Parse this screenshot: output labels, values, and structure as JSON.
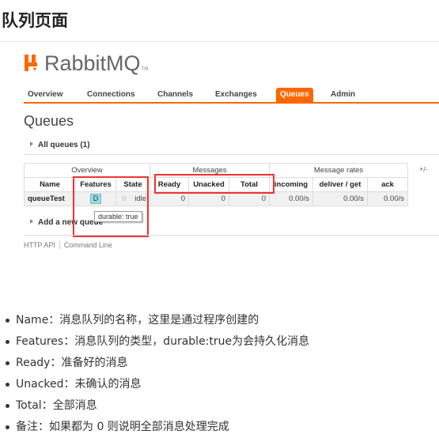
{
  "page": {
    "title": "队列页面"
  },
  "app": {
    "logo_text": "RabbitMQ",
    "logo_tm": "TM",
    "brand_color": "#ff6600"
  },
  "nav": {
    "tabs": [
      {
        "label": "Overview"
      },
      {
        "label": "Connections"
      },
      {
        "label": "Channels"
      },
      {
        "label": "Exchanges"
      },
      {
        "label": "Queues",
        "active": true
      },
      {
        "label": "Admin"
      }
    ]
  },
  "main": {
    "heading": "Queues",
    "all_queues_label": "All queues (1)",
    "add_queue_label": "Add a new queue",
    "plus_minus": "+/-"
  },
  "table": {
    "groups": {
      "overview": "Overview",
      "messages": "Messages",
      "rates": "Message rates"
    },
    "columns": {
      "name": "Name",
      "features": "Features",
      "state": "State",
      "ready": "Ready",
      "unacked": "Unacked",
      "total": "Total",
      "incoming": "incoming",
      "deliver_get": "deliver / get",
      "ack": "ack"
    },
    "rows": [
      {
        "name": "queueTest",
        "features": "D",
        "state": "idle",
        "ready": "0",
        "unacked": "0",
        "total": "0",
        "incoming": "0.00/s",
        "deliver_get": "0.00/s",
        "ack": "0.00/s"
      }
    ],
    "tooltip": "durable: true"
  },
  "footer": {
    "http_api": "HTTP API",
    "command_line": "Command Line"
  },
  "notes": [
    "Name：消息队列的名称，这里是通过程序创建的",
    "Features：消息队列的类型，durable:true为会持久化消息",
    "Ready：准备好的消息",
    "Unacked：未确认的消息",
    "Total：全部消息",
    "备注：如果都为 0 则说明全部消息处理完成"
  ],
  "highlight_color": "#e33333"
}
